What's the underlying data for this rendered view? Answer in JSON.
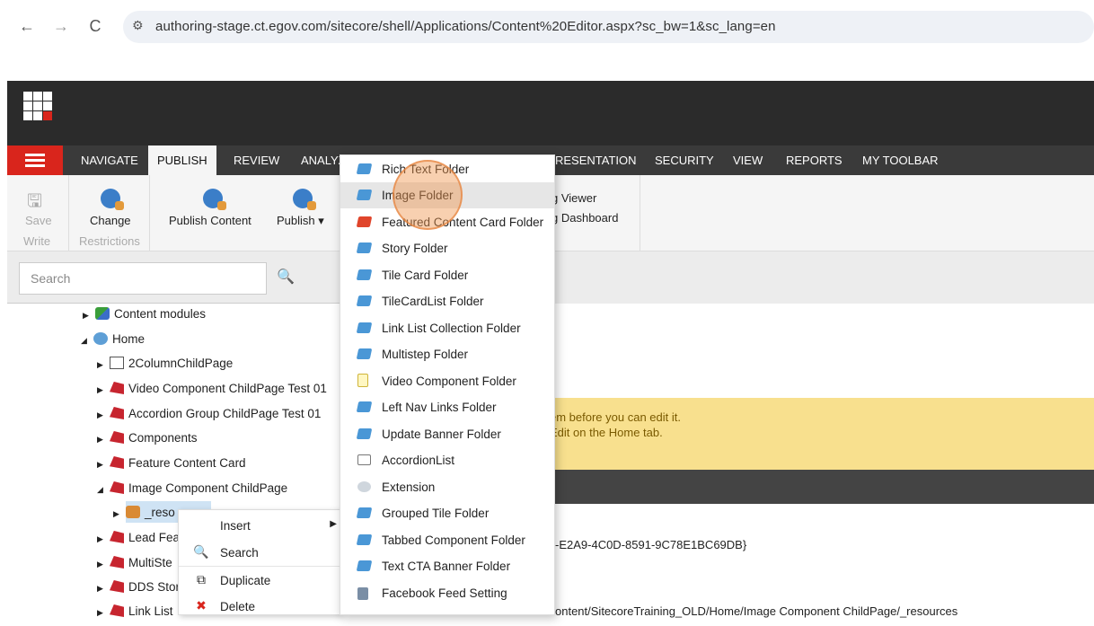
{
  "browser": {
    "url": "authoring-stage.ct.egov.com/sitecore/shell/Applications/Content%20Editor.aspx?sc_bw=1&sc_lang=en",
    "back_icon": "←",
    "forward_icon": "→",
    "reload_icon": "C",
    "site_settings_icon": "⚙"
  },
  "tabs": [
    {
      "label": "NAVIGATE"
    },
    {
      "label": "PUBLISH"
    },
    {
      "label": "REVIEW"
    },
    {
      "label": "ANALYZ"
    },
    {
      "label": "RESENTATION"
    },
    {
      "label": "SECURITY"
    },
    {
      "label": "VIEW"
    },
    {
      "label": "REPORTS"
    },
    {
      "label": "MY TOOLBAR"
    }
  ],
  "ribbon": {
    "save": "Save",
    "write": "Write",
    "change": "Change",
    "restrictions": "Restrictions",
    "publish_content": "Publish Content",
    "publish": "Publish ▾",
    "viewer": "g Viewer",
    "dashboard": "g Dashboard"
  },
  "search": {
    "placeholder": "Search",
    "icon": "🔍"
  },
  "tree": [
    {
      "label": "Content modules"
    },
    {
      "label": "Home"
    },
    {
      "label": "2ColumnChildPage"
    },
    {
      "label": "Video Component ChildPage Test 01"
    },
    {
      "label": "Accordion Group ChildPage Test 01"
    },
    {
      "label": "Components"
    },
    {
      "label": "Feature Content Card"
    },
    {
      "label": "Image Component ChildPage"
    },
    {
      "label": "_reso"
    },
    {
      "label": "Lead Fea"
    },
    {
      "label": "MultiSte"
    },
    {
      "label": "DDS Stor"
    },
    {
      "label": "Link List"
    }
  ],
  "context_menu": [
    {
      "label": "Insert",
      "icon": ""
    },
    {
      "label": "Search",
      "icon": "🔍"
    },
    {
      "label": "Duplicate",
      "icon": "⧉"
    },
    {
      "label": "Delete",
      "icon": "✖"
    }
  ],
  "insert_menu": [
    {
      "label": "Rich Text Folder"
    },
    {
      "label": "Image Folder"
    },
    {
      "label": "Featured Content Card Folder"
    },
    {
      "label": "Story Folder"
    },
    {
      "label": "Tile Card Folder"
    },
    {
      "label": "TileCardList Folder"
    },
    {
      "label": "Link List Collection Folder"
    },
    {
      "label": "Multistep Folder"
    },
    {
      "label": "Video Component Folder"
    },
    {
      "label": "Left Nav Links Folder"
    },
    {
      "label": "Update Banner Folder"
    },
    {
      "label": "AccordionList"
    },
    {
      "label": "Extension"
    },
    {
      "label": "Grouped Tile Folder"
    },
    {
      "label": "Tabbed Component Folder"
    },
    {
      "label": "Text CTA Banner Folder"
    },
    {
      "label": "Facebook Feed Setting"
    }
  ],
  "content": {
    "warning_line1": "em before you can edit it.",
    "warning_line2": "Edit on the Home tab.",
    "item_id": "-E2A9-4C0D-8591-9C78E1BC69DB}",
    "item_path": "ontent/SitecoreTraining_OLD/Home/Image Component ChildPage/_resources"
  },
  "colors": {
    "accent_red": "#d9251c",
    "warning_bg": "#f8e08e",
    "header_dark": "#2b2b2b"
  }
}
